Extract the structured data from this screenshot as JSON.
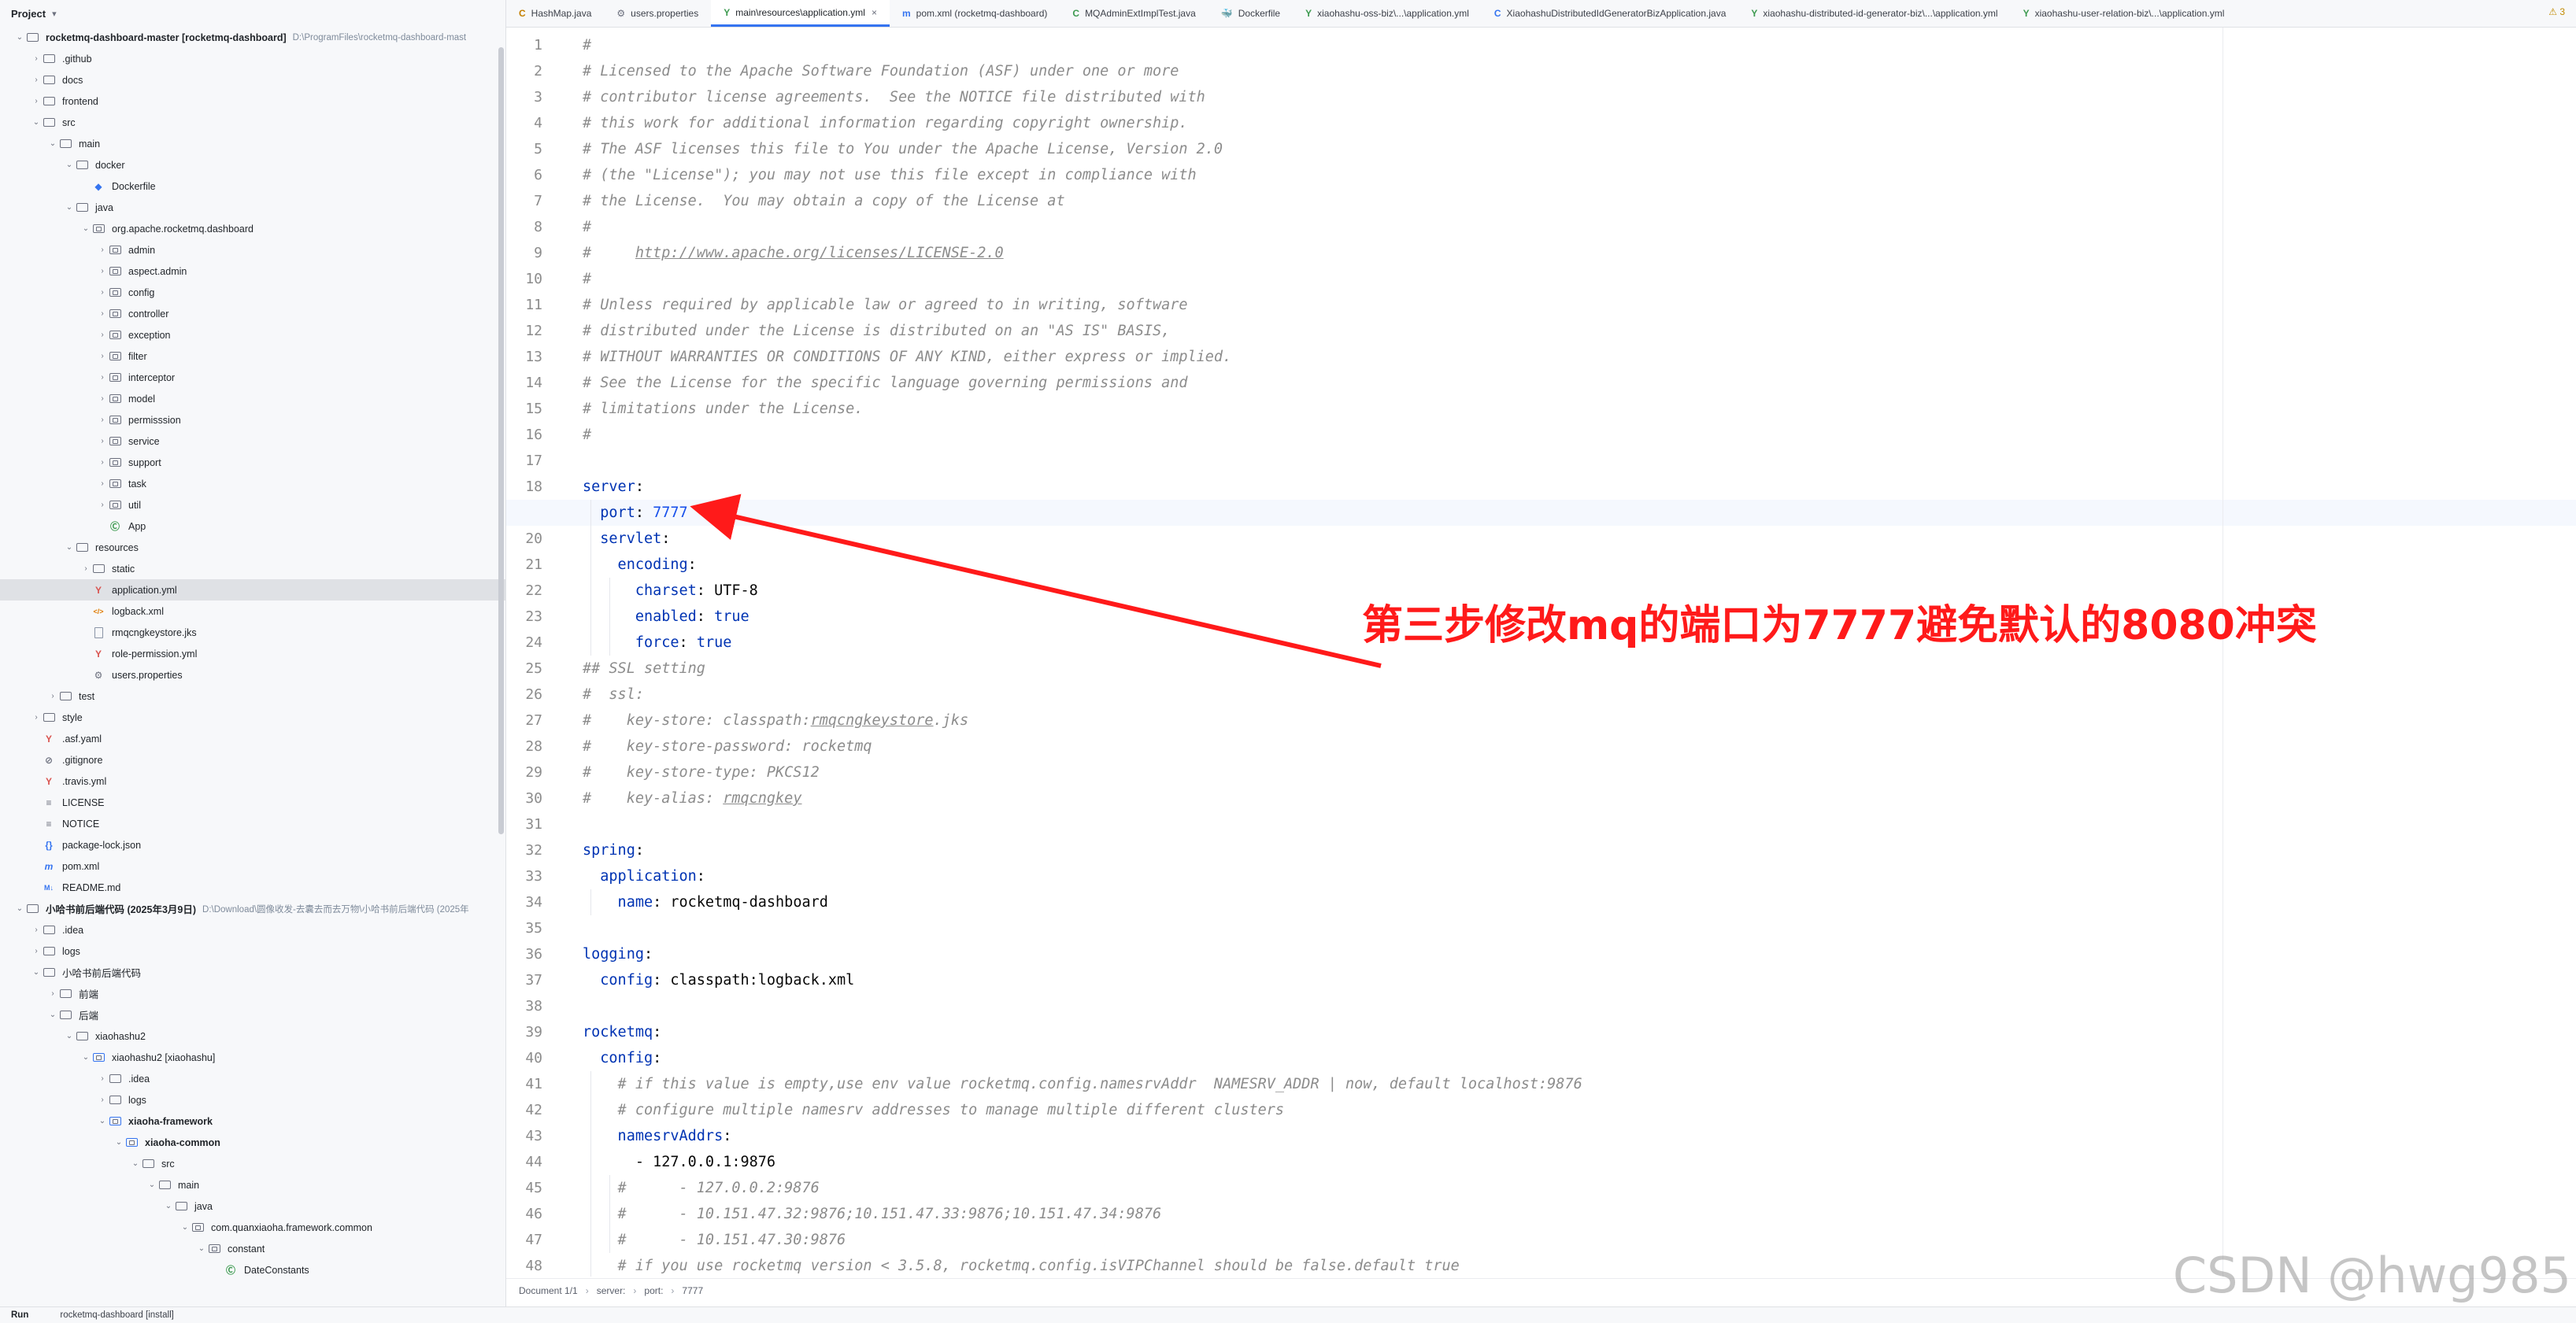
{
  "project": {
    "title": "Project",
    "rows": [
      {
        "depth": 0,
        "arrow": "open",
        "icon": "folder",
        "label": "rocketmq-dashboard-master [rocketmq-dashboard]",
        "bold": true,
        "hint": "D:\\ProgramFiles\\rocketmq-dashboard-mast"
      },
      {
        "depth": 1,
        "arrow": "closed",
        "icon": "folder",
        "label": ".github"
      },
      {
        "depth": 1,
        "arrow": "closed",
        "icon": "folder",
        "label": "docs"
      },
      {
        "depth": 1,
        "arrow": "closed",
        "icon": "folder",
        "label": "frontend"
      },
      {
        "depth": 1,
        "arrow": "open",
        "icon": "folder",
        "label": "src"
      },
      {
        "depth": 2,
        "arrow": "open",
        "icon": "folder",
        "label": "main"
      },
      {
        "depth": 3,
        "arrow": "open",
        "icon": "folder",
        "label": "docker"
      },
      {
        "depth": 4,
        "arrow": "none",
        "icon": "docker",
        "label": "Dockerfile"
      },
      {
        "depth": 3,
        "arrow": "open",
        "icon": "folder",
        "label": "java"
      },
      {
        "depth": 4,
        "arrow": "open",
        "icon": "package",
        "label": "org.apache.rocketmq.dashboard"
      },
      {
        "depth": 5,
        "arrow": "closed",
        "icon": "package",
        "label": "admin"
      },
      {
        "depth": 5,
        "arrow": "closed",
        "icon": "package",
        "label": "aspect.admin"
      },
      {
        "depth": 5,
        "arrow": "closed",
        "icon": "package",
        "label": "config"
      },
      {
        "depth": 5,
        "arrow": "closed",
        "icon": "package",
        "label": "controller"
      },
      {
        "depth": 5,
        "arrow": "closed",
        "icon": "package",
        "label": "exception"
      },
      {
        "depth": 5,
        "arrow": "closed",
        "icon": "package",
        "label": "filter"
      },
      {
        "depth": 5,
        "arrow": "closed",
        "icon": "package",
        "label": "interceptor"
      },
      {
        "depth": 5,
        "arrow": "closed",
        "icon": "package",
        "label": "model"
      },
      {
        "depth": 5,
        "arrow": "closed",
        "icon": "package",
        "label": "permisssion"
      },
      {
        "depth": 5,
        "arrow": "closed",
        "icon": "package",
        "label": "service"
      },
      {
        "depth": 5,
        "arrow": "closed",
        "icon": "package",
        "label": "support"
      },
      {
        "depth": 5,
        "arrow": "closed",
        "icon": "package",
        "label": "task"
      },
      {
        "depth": 5,
        "arrow": "closed",
        "icon": "package",
        "label": "util"
      },
      {
        "depth": 5,
        "arrow": "none",
        "icon": "class",
        "label": "App"
      },
      {
        "depth": 3,
        "arrow": "open",
        "icon": "folder",
        "label": "resources"
      },
      {
        "depth": 4,
        "arrow": "closed",
        "icon": "folder",
        "label": "static"
      },
      {
        "depth": 4,
        "arrow": "none",
        "icon": "yaml",
        "label": "application.yml",
        "selected": true
      },
      {
        "depth": 4,
        "arrow": "none",
        "icon": "xml",
        "label": "logback.xml"
      },
      {
        "depth": 4,
        "arrow": "none",
        "icon": "file",
        "label": "rmqcngkeystore.jks"
      },
      {
        "depth": 4,
        "arrow": "none",
        "icon": "yaml",
        "label": "role-permission.yml"
      },
      {
        "depth": 4,
        "arrow": "none",
        "icon": "gear",
        "label": "users.properties"
      },
      {
        "depth": 2,
        "arrow": "closed",
        "icon": "folder",
        "label": "test"
      },
      {
        "depth": 1,
        "arrow": "closed",
        "icon": "folder",
        "label": "style"
      },
      {
        "depth": 1,
        "arrow": "none",
        "icon": "yaml",
        "label": ".asf.yaml"
      },
      {
        "depth": 1,
        "arrow": "none",
        "icon": "ignore",
        "label": ".gitignore"
      },
      {
        "depth": 1,
        "arrow": "none",
        "icon": "yaml",
        "label": ".travis.yml"
      },
      {
        "depth": 1,
        "arrow": "none",
        "icon": "text",
        "label": "LICENSE"
      },
      {
        "depth": 1,
        "arrow": "none",
        "icon": "text",
        "label": "NOTICE"
      },
      {
        "depth": 1,
        "arrow": "none",
        "icon": "json",
        "label": "package-lock.json"
      },
      {
        "depth": 1,
        "arrow": "none",
        "icon": "maven",
        "label": "pom.xml"
      },
      {
        "depth": 1,
        "arrow": "none",
        "icon": "md",
        "label": "README.md"
      },
      {
        "depth": 0,
        "arrow": "open",
        "icon": "folder",
        "label": "小哈书前后端代码 (2025年3月9日)",
        "bold": true,
        "hint": "D:\\Download\\圆像收发-去囊去而去万物\\小哈书前后端代码 (2025年"
      },
      {
        "depth": 1,
        "arrow": "closed",
        "icon": "folder",
        "label": ".idea"
      },
      {
        "depth": 1,
        "arrow": "closed",
        "icon": "folder",
        "label": "logs"
      },
      {
        "depth": 1,
        "arrow": "open",
        "icon": "folder",
        "label": "小哈书前后端代码"
      },
      {
        "depth": 2,
        "arrow": "closed",
        "icon": "folder",
        "label": "前端"
      },
      {
        "depth": 2,
        "arrow": "open",
        "icon": "folder",
        "label": "后端"
      },
      {
        "depth": 3,
        "arrow": "open",
        "icon": "folder",
        "label": "xiaohashu2"
      },
      {
        "depth": 4,
        "arrow": "open",
        "icon": "module",
        "label": "xiaohashu2 [xiaohashu]"
      },
      {
        "depth": 5,
        "arrow": "closed",
        "icon": "folder",
        "label": ".idea"
      },
      {
        "depth": 5,
        "arrow": "closed",
        "icon": "folder",
        "label": "logs"
      },
      {
        "depth": 5,
        "arrow": "open",
        "icon": "module",
        "label": "xiaoha-framework",
        "bold": true
      },
      {
        "depth": 6,
        "arrow": "open",
        "icon": "module",
        "label": "xiaoha-common",
        "bold": true
      },
      {
        "depth": 7,
        "arrow": "open",
        "icon": "folder",
        "label": "src"
      },
      {
        "depth": 8,
        "arrow": "open",
        "icon": "folder",
        "label": "main"
      },
      {
        "depth": 9,
        "arrow": "open",
        "icon": "folder",
        "label": "java"
      },
      {
        "depth": 10,
        "arrow": "open",
        "icon": "package",
        "label": "com.quanxiaoha.framework.common"
      },
      {
        "depth": 11,
        "arrow": "open",
        "icon": "package",
        "label": "constant"
      },
      {
        "depth": 12,
        "arrow": "none",
        "icon": "class",
        "label": "DateConstants"
      }
    ]
  },
  "tabs": [
    {
      "label": "HashMap.java",
      "icon": "C",
      "color": "#c47f00"
    },
    {
      "label": "users.properties",
      "icon": "⚙",
      "color": "#6c707e"
    },
    {
      "label": "main\\resources\\application.yml",
      "icon": "Y",
      "color": "#3d9a50",
      "active": true
    },
    {
      "label": "pom.xml (rocketmq-dashboard)",
      "icon": "m",
      "color": "#3574f0"
    },
    {
      "label": "MQAdminExtImplTest.java",
      "icon": "C",
      "color": "#3d9a50"
    },
    {
      "label": "Dockerfile",
      "icon": "🐳",
      "color": "#3574f0"
    },
    {
      "label": "xiaohashu-oss-biz\\...\\application.yml",
      "icon": "Y",
      "color": "#3d9a50"
    },
    {
      "label": "XiaohashuDistributedIdGeneratorBizApplication.java",
      "icon": "C",
      "color": "#3574f0"
    },
    {
      "label": "xiaohashu-distributed-id-generator-biz\\...\\application.yml",
      "icon": "Y",
      "color": "#3d9a50"
    },
    {
      "label": "xiaohashu-user-relation-biz\\...\\application.yml",
      "icon": "Y",
      "color": "#3d9a50"
    }
  ],
  "warnings_badge": "⚠ 3",
  "editor": {
    "current_line": 19,
    "lines": [
      {
        "n": "1",
        "segs": [
          {
            "t": "#",
            "c": "comment"
          }
        ]
      },
      {
        "n": "2",
        "segs": [
          {
            "t": "# Licensed to the Apache Software Foundation (ASF) under one or more",
            "c": "comment"
          }
        ]
      },
      {
        "n": "3",
        "segs": [
          {
            "t": "# contributor license agreements.  See the NOTICE file distributed with",
            "c": "comment"
          }
        ]
      },
      {
        "n": "4",
        "segs": [
          {
            "t": "# this work for additional information regarding copyright ownership.",
            "c": "comment"
          }
        ]
      },
      {
        "n": "5",
        "segs": [
          {
            "t": "# The ASF licenses this file to You under the Apache License, Version 2.0",
            "c": "comment"
          }
        ]
      },
      {
        "n": "6",
        "segs": [
          {
            "t": "# (the \"License\"); you may not use this file except in compliance with",
            "c": "comment"
          }
        ]
      },
      {
        "n": "7",
        "segs": [
          {
            "t": "# the License.  You may obtain a copy of the License at",
            "c": "comment"
          }
        ]
      },
      {
        "n": "8",
        "segs": [
          {
            "t": "#",
            "c": "comment"
          }
        ]
      },
      {
        "n": "9",
        "segs": [
          {
            "t": "#     ",
            "c": "comment"
          },
          {
            "t": "http://www.apache.org/licenses/LICENSE-2.0",
            "c": "link"
          }
        ]
      },
      {
        "n": "10",
        "segs": [
          {
            "t": "#",
            "c": "comment"
          }
        ]
      },
      {
        "n": "11",
        "segs": [
          {
            "t": "# Unless required by applicable law or agreed to in writing, software",
            "c": "comment"
          }
        ]
      },
      {
        "n": "12",
        "segs": [
          {
            "t": "# distributed under the License is distributed on an \"AS IS\" BASIS,",
            "c": "comment"
          }
        ]
      },
      {
        "n": "13",
        "segs": [
          {
            "t": "# WITHOUT WARRANTIES OR CONDITIONS OF ANY KIND, either express or implied.",
            "c": "comment"
          }
        ]
      },
      {
        "n": "14",
        "segs": [
          {
            "t": "# See the License for the specific language governing permissions and",
            "c": "comment"
          }
        ]
      },
      {
        "n": "15",
        "segs": [
          {
            "t": "# limitations under the License.",
            "c": "comment"
          }
        ]
      },
      {
        "n": "16",
        "segs": [
          {
            "t": "#",
            "c": "comment"
          }
        ]
      },
      {
        "n": "17",
        "segs": []
      },
      {
        "n": "18",
        "segs": [
          {
            "t": "server",
            "c": "key"
          },
          {
            "t": ":",
            "c": "str"
          }
        ]
      },
      {
        "n": "19",
        "segs": [
          {
            "t": "  port",
            "c": "key"
          },
          {
            "t": ": ",
            "c": "str"
          },
          {
            "t": "7777",
            "c": "num"
          }
        ]
      },
      {
        "n": "20",
        "segs": [
          {
            "t": "  servlet",
            "c": "key"
          },
          {
            "t": ":",
            "c": "str"
          }
        ]
      },
      {
        "n": "21",
        "segs": [
          {
            "t": "    encoding",
            "c": "key"
          },
          {
            "t": ":",
            "c": "str"
          }
        ]
      },
      {
        "n": "22",
        "segs": [
          {
            "t": "      charset",
            "c": "key"
          },
          {
            "t": ": UTF-8",
            "c": "str"
          }
        ]
      },
      {
        "n": "23",
        "segs": [
          {
            "t": "      enabled",
            "c": "key"
          },
          {
            "t": ": ",
            "c": "str"
          },
          {
            "t": "true",
            "c": "bool"
          }
        ]
      },
      {
        "n": "24",
        "segs": [
          {
            "t": "      force",
            "c": "key"
          },
          {
            "t": ": ",
            "c": "str"
          },
          {
            "t": "true",
            "c": "bool"
          }
        ]
      },
      {
        "n": "25",
        "segs": [
          {
            "t": "## SSL setting",
            "c": "comment"
          }
        ]
      },
      {
        "n": "26",
        "segs": [
          {
            "t": "#  ssl:",
            "c": "comment"
          }
        ]
      },
      {
        "n": "27",
        "segs": [
          {
            "t": "#    key-store: classpath:",
            "c": "comment"
          },
          {
            "t": "rmqcngkeystore",
            "c": "link"
          },
          {
            "t": ".jks",
            "c": "comment"
          }
        ]
      },
      {
        "n": "28",
        "segs": [
          {
            "t": "#    key-store-password: rocketmq",
            "c": "comment"
          }
        ]
      },
      {
        "n": "29",
        "segs": [
          {
            "t": "#    key-store-type: PKCS12",
            "c": "comment"
          }
        ]
      },
      {
        "n": "30",
        "segs": [
          {
            "t": "#    key-alias: ",
            "c": "comment"
          },
          {
            "t": "rmqcngkey",
            "c": "link"
          }
        ]
      },
      {
        "n": "31",
        "segs": []
      },
      {
        "n": "32",
        "segs": [
          {
            "t": "spring",
            "c": "key"
          },
          {
            "t": ":",
            "c": "str"
          }
        ]
      },
      {
        "n": "33",
        "segs": [
          {
            "t": "  application",
            "c": "key"
          },
          {
            "t": ":",
            "c": "str"
          }
        ]
      },
      {
        "n": "34",
        "segs": [
          {
            "t": "    name",
            "c": "key"
          },
          {
            "t": ": rocketmq-dashboard",
            "c": "str"
          }
        ]
      },
      {
        "n": "35",
        "segs": []
      },
      {
        "n": "36",
        "segs": [
          {
            "t": "logging",
            "c": "key"
          },
          {
            "t": ":",
            "c": "str"
          }
        ]
      },
      {
        "n": "37",
        "segs": [
          {
            "t": "  config",
            "c": "key"
          },
          {
            "t": ": classpath:logback.xml",
            "c": "str"
          }
        ]
      },
      {
        "n": "38",
        "segs": []
      },
      {
        "n": "39",
        "segs": [
          {
            "t": "rocketmq",
            "c": "key"
          },
          {
            "t": ":",
            "c": "str"
          }
        ]
      },
      {
        "n": "40",
        "segs": [
          {
            "t": "  config",
            "c": "key"
          },
          {
            "t": ":",
            "c": "str"
          }
        ]
      },
      {
        "n": "41",
        "segs": [
          {
            "t": "    # if this value is empty,use env value rocketmq.config.namesrvAddr  NAMESRV_ADDR | now, default localhost:9876",
            "c": "comment"
          }
        ]
      },
      {
        "n": "42",
        "segs": [
          {
            "t": "    # configure multiple namesrv addresses to manage multiple different clusters",
            "c": "comment"
          }
        ]
      },
      {
        "n": "43",
        "segs": [
          {
            "t": "    namesrvAddrs",
            "c": "key"
          },
          {
            "t": ":",
            "c": "str"
          }
        ]
      },
      {
        "n": "44",
        "segs": [
          {
            "t": "      - 127.0.0.1:9876",
            "c": "str"
          }
        ]
      },
      {
        "n": "45",
        "segs": [
          {
            "t": "    #      - 127.0.0.2:9876",
            "c": "comment"
          }
        ]
      },
      {
        "n": "46",
        "segs": [
          {
            "t": "    #      - 10.151.47.32:9876;10.151.47.33:9876;10.151.47.34:9876",
            "c": "comment"
          }
        ]
      },
      {
        "n": "47",
        "segs": [
          {
            "t": "    #      - 10.151.47.30:9876",
            "c": "comment"
          }
        ]
      },
      {
        "n": "48",
        "segs": [
          {
            "t": "    # if you use rocketmq version < 3.5.8, rocketmq.config.isVIPChannel should be false.default true",
            "c": "comment"
          }
        ]
      }
    ]
  },
  "annotation": {
    "text": "第三步修改mq的端口为7777避免默认的8080冲突",
    "color": "#ff1a1a"
  },
  "breadcrumbs": [
    "Document 1/1",
    "server:",
    "port:",
    "7777"
  ],
  "bottom": {
    "run_label": "Run",
    "run_config": "rocketmq-dashboard [install]"
  },
  "watermark": "CSDN @hwg985"
}
